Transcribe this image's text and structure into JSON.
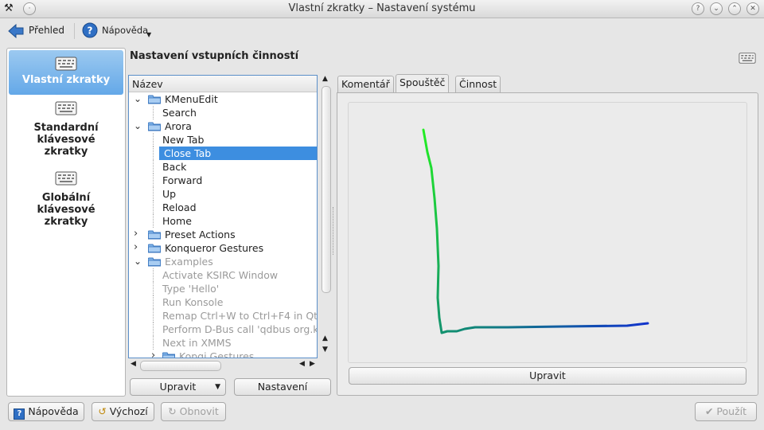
{
  "window": {
    "title": "Vlastní zkratky – Nastavení systému",
    "titlebar_buttons": [
      "?",
      "⌄",
      "⌃",
      "✕"
    ]
  },
  "toolbar": {
    "overview_label": "Přehled",
    "help_label": "Nápověda"
  },
  "sidebar": {
    "items": [
      {
        "label": "Vlastní zkratky",
        "selected": true
      },
      {
        "label": "Standardní klávesové zkratky",
        "selected": false
      },
      {
        "label": "Globální klávesové zkratky",
        "selected": false
      }
    ]
  },
  "main": {
    "heading": "Nastavení vstupních činností",
    "tree": {
      "column_header": "Název",
      "rows": [
        {
          "label": "KMenuEdit",
          "level": 0,
          "folder": true,
          "expanded": true,
          "disabled": false,
          "selected": false
        },
        {
          "label": "Search",
          "level": 1,
          "folder": false,
          "disabled": false,
          "selected": false
        },
        {
          "label": "Arora",
          "level": 0,
          "folder": true,
          "expanded": true,
          "disabled": false,
          "selected": false
        },
        {
          "label": "New Tab",
          "level": 1,
          "folder": false,
          "disabled": false,
          "selected": false
        },
        {
          "label": "Close Tab",
          "level": 1,
          "folder": false,
          "disabled": false,
          "selected": true
        },
        {
          "label": "Back",
          "level": 1,
          "folder": false,
          "disabled": false,
          "selected": false
        },
        {
          "label": "Forward",
          "level": 1,
          "folder": false,
          "disabled": false,
          "selected": false
        },
        {
          "label": "Up",
          "level": 1,
          "folder": false,
          "disabled": false,
          "selected": false
        },
        {
          "label": "Reload",
          "level": 1,
          "folder": false,
          "disabled": false,
          "selected": false
        },
        {
          "label": "Home",
          "level": 1,
          "folder": false,
          "disabled": false,
          "selected": false
        },
        {
          "label": "Preset Actions",
          "level": 0,
          "folder": true,
          "expanded": false,
          "disabled": false,
          "selected": false
        },
        {
          "label": "Konqueror Gestures",
          "level": 0,
          "folder": true,
          "expanded": false,
          "disabled": false,
          "selected": false
        },
        {
          "label": "Examples",
          "level": 0,
          "folder": true,
          "expanded": true,
          "disabled": true,
          "selected": false
        },
        {
          "label": "Activate KSIRC Window",
          "level": 1,
          "folder": false,
          "disabled": true,
          "selected": false
        },
        {
          "label": "Type 'Hello'",
          "level": 1,
          "folder": false,
          "disabled": true,
          "selected": false
        },
        {
          "label": "Run Konsole",
          "level": 1,
          "folder": false,
          "disabled": true,
          "selected": false
        },
        {
          "label": "Remap Ctrl+W to Ctrl+F4 in Qt",
          "level": 1,
          "folder": false,
          "disabled": true,
          "selected": false
        },
        {
          "label": "Perform D-Bus call 'qdbus org.k",
          "level": 1,
          "folder": false,
          "disabled": true,
          "selected": false
        },
        {
          "label": "Next in XMMS",
          "level": 1,
          "folder": false,
          "disabled": true,
          "selected": false
        },
        {
          "label": "Kopgi Gestures",
          "level": 1,
          "folder": true,
          "expanded": false,
          "disabled": true,
          "selected": false
        }
      ]
    },
    "edit_button": "Upravit",
    "settings_button": "Nastavení",
    "tabs": [
      {
        "label": "Komentář",
        "active": false
      },
      {
        "label": "Spouštěč",
        "active": true
      },
      {
        "label": "Činnost",
        "active": false
      }
    ],
    "gesture_edit_button": "Upravit"
  },
  "bottom": {
    "help_button": "Nápověda",
    "defaults_button": "Výchozí",
    "reset_button": "Obnovit",
    "apply_button": "Použít"
  },
  "colors": {
    "selection": "#3d8ee0",
    "gesture_start": "#22ee22",
    "gesture_end": "#1133cc"
  }
}
